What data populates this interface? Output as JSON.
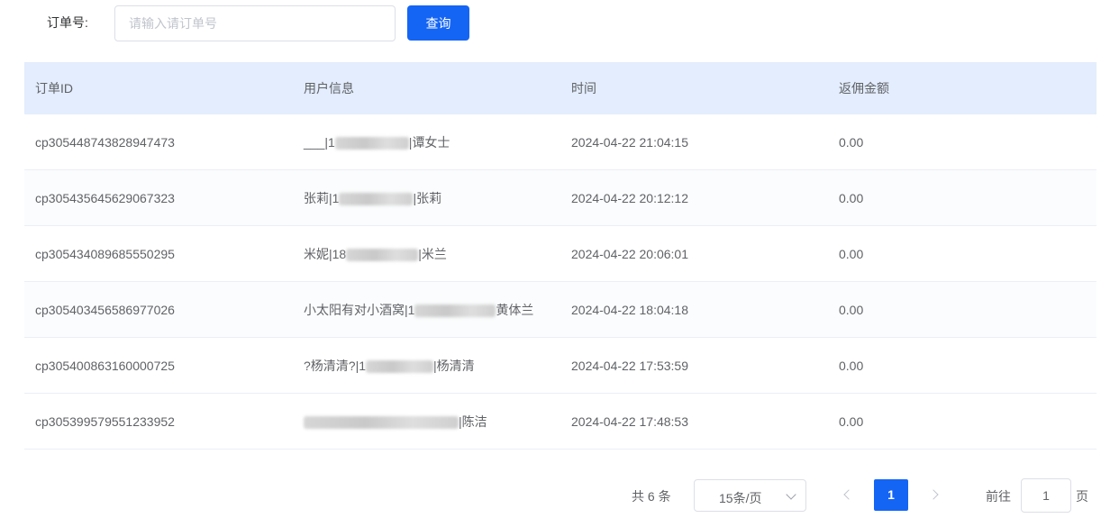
{
  "search": {
    "label": "订单号:",
    "placeholder": "请输入请订单号",
    "value": "",
    "button_label": "查询"
  },
  "table": {
    "headers": [
      "订单ID",
      "用户信息",
      "时间",
      "返佣金额"
    ],
    "rows": [
      {
        "order_id": "cp305448743828947473",
        "user_prefix": "___|1",
        "user_suffix": "|谭女士",
        "time": "2024-04-22 21:04:15",
        "amount": "0.00"
      },
      {
        "order_id": "cp305435645629067323",
        "user_prefix": "张莉|1",
        "user_suffix": "|张莉",
        "time": "2024-04-22 20:12:12",
        "amount": "0.00"
      },
      {
        "order_id": "cp305434089685550295",
        "user_prefix": "米妮|18",
        "user_suffix": "|米兰",
        "time": "2024-04-22 20:06:01",
        "amount": "0.00"
      },
      {
        "order_id": "cp305403456586977026",
        "user_prefix": "小太阳有对小酒窝|1",
        "user_suffix": "黄体兰",
        "time": "2024-04-22 18:04:18",
        "amount": "0.00"
      },
      {
        "order_id": "cp305400863160000725",
        "user_prefix": "?杨清清?|1",
        "user_suffix": "|杨清清",
        "time": "2024-04-22 17:53:59",
        "amount": "0.00"
      },
      {
        "order_id": "cp305399579551233952",
        "user_prefix": "",
        "user_suffix": "|陈洁",
        "time": "2024-04-22 17:48:53",
        "amount": "0.00"
      }
    ]
  },
  "pagination": {
    "total": "共 6 条",
    "page_size": "15条/页",
    "current_page": "1",
    "goto_label": "前往",
    "goto_value": "1",
    "goto_suffix": "页"
  },
  "colors": {
    "primary": "#1565f5",
    "header_bg": "#e3edfd"
  }
}
